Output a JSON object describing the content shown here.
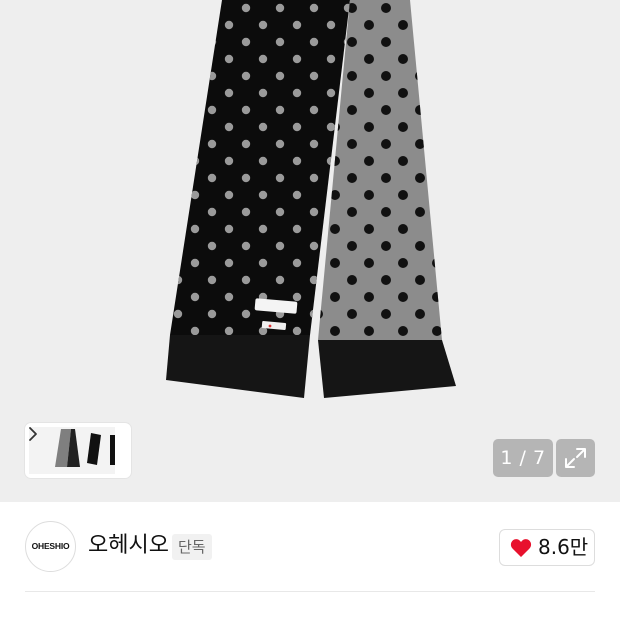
{
  "gallery": {
    "counter": "1 / 7",
    "thumbnail_icon": "chevron-right-icon",
    "expand_icon": "expand-icon"
  },
  "brand": {
    "logo_text": "OHESHIO",
    "name": "오헤시오",
    "tag": "단독"
  },
  "like": {
    "icon": "heart-icon",
    "icon_color": "#e8112d",
    "count": "8.6만"
  }
}
